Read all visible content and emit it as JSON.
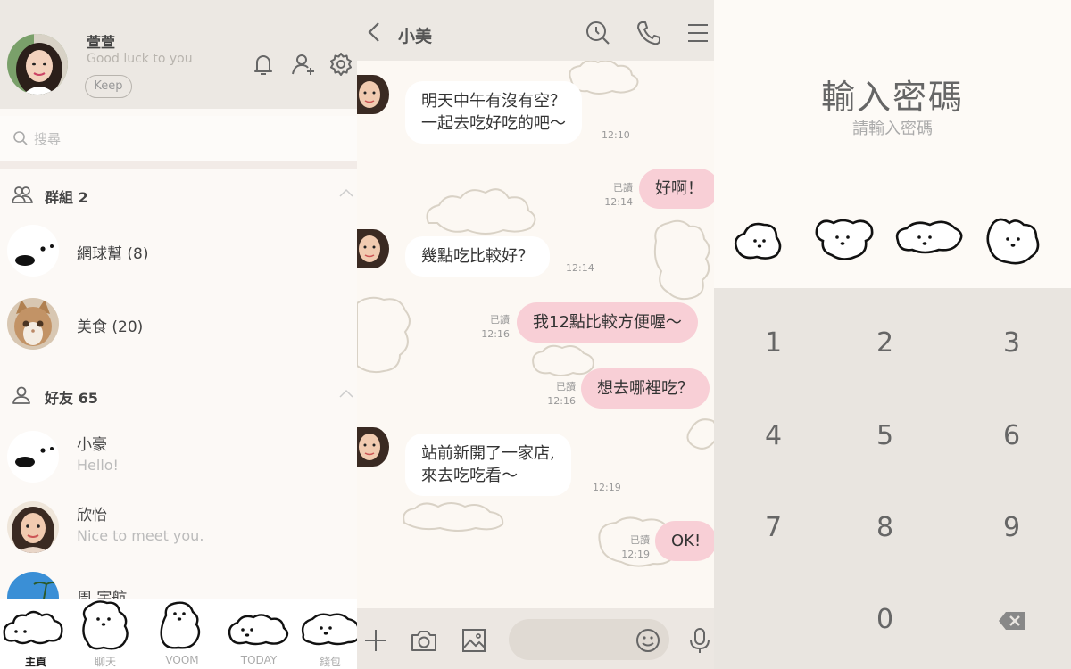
{
  "colors": {
    "header_bg": "#ece8e3",
    "bubble_out": "#f8cfd6",
    "bubble_in": "#ffffff",
    "keypad_bg": "#e9e5e0",
    "accent_text": "#444444"
  },
  "home": {
    "profile": {
      "name": "萱萱",
      "status": "Good luck to you",
      "keep_label": "Keep"
    },
    "header_icons": [
      "bell-icon",
      "add-friend-icon",
      "gear-icon"
    ],
    "search": {
      "placeholder": "搜尋"
    },
    "groups": {
      "label": "群組 2",
      "items": [
        {
          "name": "網球幫 (8)",
          "avatar": "dog-face"
        },
        {
          "name": "美食 (20)",
          "avatar": "cat-photo"
        }
      ]
    },
    "friends": {
      "label": "好友 65",
      "items": [
        {
          "name": "小豪",
          "status": "Hello!",
          "avatar": "dog-face"
        },
        {
          "name": "欣怡",
          "status": "Nice to meet you.",
          "avatar": "woman-photo"
        },
        {
          "name": "周 宇航",
          "status": "",
          "avatar": "beach-photo"
        }
      ]
    },
    "tabs": [
      {
        "label": "主頁",
        "active": true
      },
      {
        "label": "聊天",
        "active": false
      },
      {
        "label": "VOOM",
        "active": false
      },
      {
        "label": "TODAY",
        "active": false
      },
      {
        "label": "錢包",
        "active": false
      }
    ]
  },
  "chat": {
    "title": "小美",
    "messages": [
      {
        "side": "in",
        "lines": [
          "明天中午有沒有空？",
          "一起去吃好吃的吧～"
        ],
        "time": "12:10",
        "read": ""
      },
      {
        "side": "out",
        "lines": [
          "好啊！"
        ],
        "time": "12:14",
        "read": "已讀"
      },
      {
        "side": "in",
        "lines": [
          "幾點吃比較好？"
        ],
        "time": "12:14",
        "read": ""
      },
      {
        "side": "out",
        "lines": [
          "我12點比較方便喔～"
        ],
        "time": "12:16",
        "read": "已讀"
      },
      {
        "side": "out",
        "lines": [
          "想去哪裡吃？"
        ],
        "time": "12:16",
        "read": "已讀"
      },
      {
        "side": "in",
        "lines": [
          "站前新開了一家店,",
          "來去吃吃看～"
        ],
        "time": "12:19",
        "read": ""
      },
      {
        "side": "out",
        "lines": [
          "OK!"
        ],
        "time": "12:19",
        "read": "已讀"
      }
    ],
    "header_icons": [
      "back-icon",
      "search-icon",
      "phone-icon",
      "menu-icon"
    ],
    "composer_icons": [
      "plus-icon",
      "camera-icon",
      "image-icon",
      "emoji-icon",
      "mic-icon"
    ]
  },
  "passcode": {
    "title": "輸入密碼",
    "subtitle": "請輸入密碼",
    "keys": [
      "1",
      "2",
      "3",
      "4",
      "5",
      "6",
      "7",
      "8",
      "9",
      "",
      "0",
      "backspace-icon"
    ]
  }
}
